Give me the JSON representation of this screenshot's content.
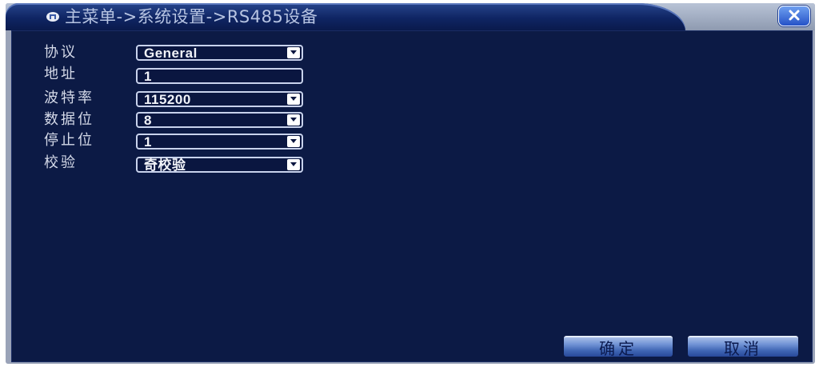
{
  "window": {
    "title": "主菜单->系统设置->RS485设备"
  },
  "form": {
    "protocol": {
      "label": "协议",
      "value": "General"
    },
    "address": {
      "label": "地址",
      "value": "1"
    },
    "baud_rate": {
      "label": "波特率",
      "value": "115200"
    },
    "data_bits": {
      "label": "数据位",
      "value": "8"
    },
    "stop_bits": {
      "label": "停止位",
      "value": "1"
    },
    "parity": {
      "label": "校验",
      "value": "奇校验"
    }
  },
  "buttons": {
    "ok": "确定",
    "cancel": "取消"
  },
  "colors": {
    "panel_bg": "#0c1a45",
    "title_bg": "#0f2563",
    "button": "#7395d6"
  },
  "icons": [
    "home-icon",
    "close-icon",
    "dropdown-arrow-icon"
  ]
}
